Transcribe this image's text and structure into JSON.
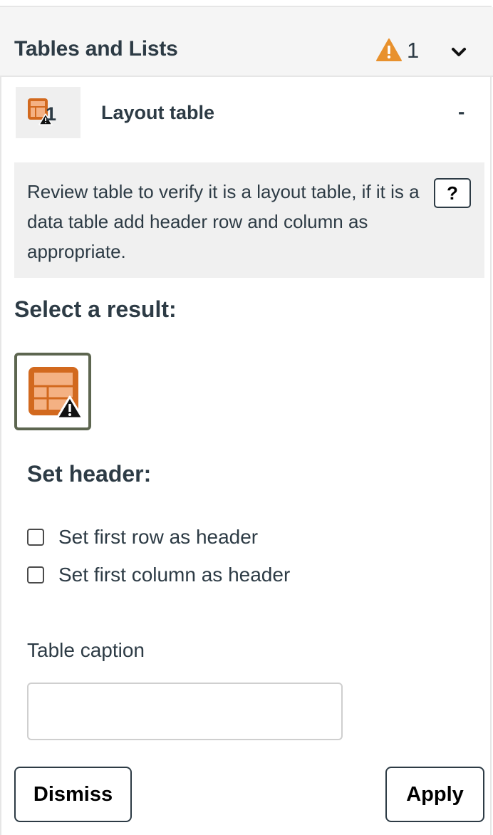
{
  "section": {
    "title": "Tables and Lists",
    "warning_count": "1",
    "warning_icon": "warning-triangle-icon",
    "warning_color": "#e8912d",
    "toggle_icon": "chevron-down-icon"
  },
  "issue": {
    "icon": "layout-table-warning-icon",
    "count": "1",
    "title": "Layout table",
    "status": "-"
  },
  "description": {
    "text": "Review table to verify it is a layout table, if it is a data table add header row and column as appropriate.",
    "help_label": "?"
  },
  "results": {
    "heading": "Select a result:",
    "option_icon": "layout-table-warning-icon"
  },
  "set_header": {
    "heading": "Set header:",
    "options": [
      {
        "label": "Set first row as header",
        "checked": false
      },
      {
        "label": "Set first column as header",
        "checked": false
      }
    ]
  },
  "caption": {
    "label": "Table caption",
    "value": "",
    "placeholder": ""
  },
  "actions": {
    "dismiss_label": "Dismiss",
    "apply_label": "Apply"
  },
  "colors": {
    "table_icon_fill": "#d2691e",
    "table_icon_light": "#f4b183",
    "text": "#2d3b45",
    "panel_bg": "#f0f0f0"
  }
}
